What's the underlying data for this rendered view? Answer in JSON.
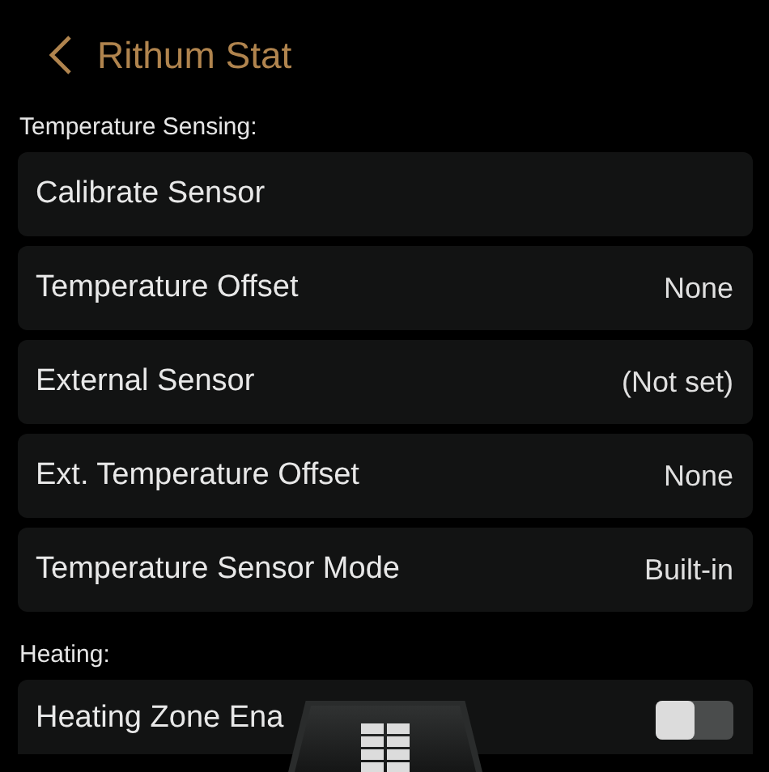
{
  "header": {
    "title": "Rithum Stat"
  },
  "sections": [
    {
      "label": "Temperature Sensing:",
      "rows": [
        {
          "kind": "action",
          "label": "Calibrate Sensor"
        },
        {
          "kind": "value",
          "label": "Temperature Offset",
          "value": "None"
        },
        {
          "kind": "value",
          "label": "External Sensor",
          "value": "(Not set)"
        },
        {
          "kind": "value",
          "label": "Ext. Temperature Offset",
          "value": "None"
        },
        {
          "kind": "value",
          "label": "Temperature Sensor Mode",
          "value": "Built-in"
        }
      ]
    },
    {
      "label": "Heating:",
      "rows": [
        {
          "kind": "toggle",
          "label": "Heating Zone Ena",
          "on": false
        }
      ]
    }
  ]
}
